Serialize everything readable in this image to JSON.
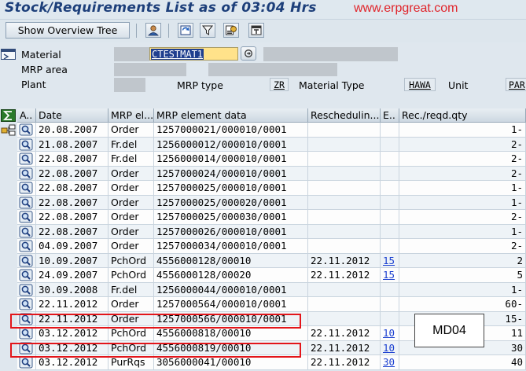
{
  "title": "Stock/Requirements List as of 03:04 Hrs",
  "watermark": "www.erpgreat.com",
  "toolbar": {
    "overview_button": "Show Overview Tree",
    "icons": [
      "person-icon",
      "refresh-icon",
      "filter-icon",
      "settings-icon",
      "export-icon"
    ]
  },
  "header": {
    "material_label": "Material",
    "material_value": "CTESTMAT1",
    "mrp_area_label": "MRP area",
    "plant_label": "Plant",
    "mrp_type_label": "MRP type",
    "mrp_type_value": "ZR",
    "material_type_label": "Material Type",
    "material_type_value": "HAWA",
    "unit_label": "Unit",
    "unit_value": "PAR"
  },
  "table": {
    "columns": [
      "A..",
      "Date",
      "MRP el...",
      "MRP element data",
      "Reschedulin...",
      "E..",
      "Rec./reqd.qty"
    ],
    "rows": [
      {
        "date": "20.08.2007",
        "element": "Order",
        "data": "1257000021/000010/0001",
        "resched": "",
        "exc": "",
        "qty": "1-"
      },
      {
        "date": "21.08.2007",
        "element": "Fr.del",
        "data": "1256000012/000010/0001",
        "resched": "",
        "exc": "",
        "qty": "2-"
      },
      {
        "date": "22.08.2007",
        "element": "Fr.del",
        "data": "1256000014/000010/0001",
        "resched": "",
        "exc": "",
        "qty": "2-"
      },
      {
        "date": "22.08.2007",
        "element": "Order",
        "data": "1257000024/000010/0001",
        "resched": "",
        "exc": "",
        "qty": "2-"
      },
      {
        "date": "22.08.2007",
        "element": "Order",
        "data": "1257000025/000010/0001",
        "resched": "",
        "exc": "",
        "qty": "1-"
      },
      {
        "date": "22.08.2007",
        "element": "Order",
        "data": "1257000025/000020/0001",
        "resched": "",
        "exc": "",
        "qty": "1-"
      },
      {
        "date": "22.08.2007",
        "element": "Order",
        "data": "1257000025/000030/0001",
        "resched": "",
        "exc": "",
        "qty": "2-"
      },
      {
        "date": "22.08.2007",
        "element": "Order",
        "data": "1257000026/000010/0001",
        "resched": "",
        "exc": "",
        "qty": "1-"
      },
      {
        "date": "04.09.2007",
        "element": "Order",
        "data": "1257000034/000010/0001",
        "resched": "",
        "exc": "",
        "qty": "2-"
      },
      {
        "date": "10.09.2007",
        "element": "PchOrd",
        "data": "4556000128/00010",
        "resched": "22.11.2012",
        "exc": "15",
        "qty": "2"
      },
      {
        "date": "24.09.2007",
        "element": "PchOrd",
        "data": "4556000128/00020",
        "resched": "22.11.2012",
        "exc": "15",
        "qty": "5"
      },
      {
        "date": "30.09.2008",
        "element": "Fr.del",
        "data": "1256000044/000010/0001",
        "resched": "",
        "exc": "",
        "qty": "1-"
      },
      {
        "date": "22.11.2012",
        "element": "Order",
        "data": "1257000564/000010/0001",
        "resched": "",
        "exc": "",
        "qty": "60-"
      },
      {
        "date": "22.11.2012",
        "element": "Order",
        "data": "1257000566/000010/0001",
        "resched": "",
        "exc": "",
        "qty": "15-"
      },
      {
        "date": "03.12.2012",
        "element": "PchOrd",
        "data": "4556000818/00010",
        "resched": "22.11.2012",
        "exc": "10",
        "qty": "11"
      },
      {
        "date": "03.12.2012",
        "element": "PchOrd",
        "data": "4556000819/00010",
        "resched": "22.11.2012",
        "exc": "10",
        "qty": "30"
      },
      {
        "date": "03.12.2012",
        "element": "PurRqs",
        "data": "3056000041/00010",
        "resched": "22.11.2012",
        "exc": "30",
        "qty": "40"
      }
    ]
  },
  "callout": "MD04",
  "colors": {
    "title": "#1d3f7a",
    "watermark": "#e0242a",
    "highlight": "#e3151a",
    "link": "#1a3fd0",
    "material_field": "#ffe28a"
  }
}
